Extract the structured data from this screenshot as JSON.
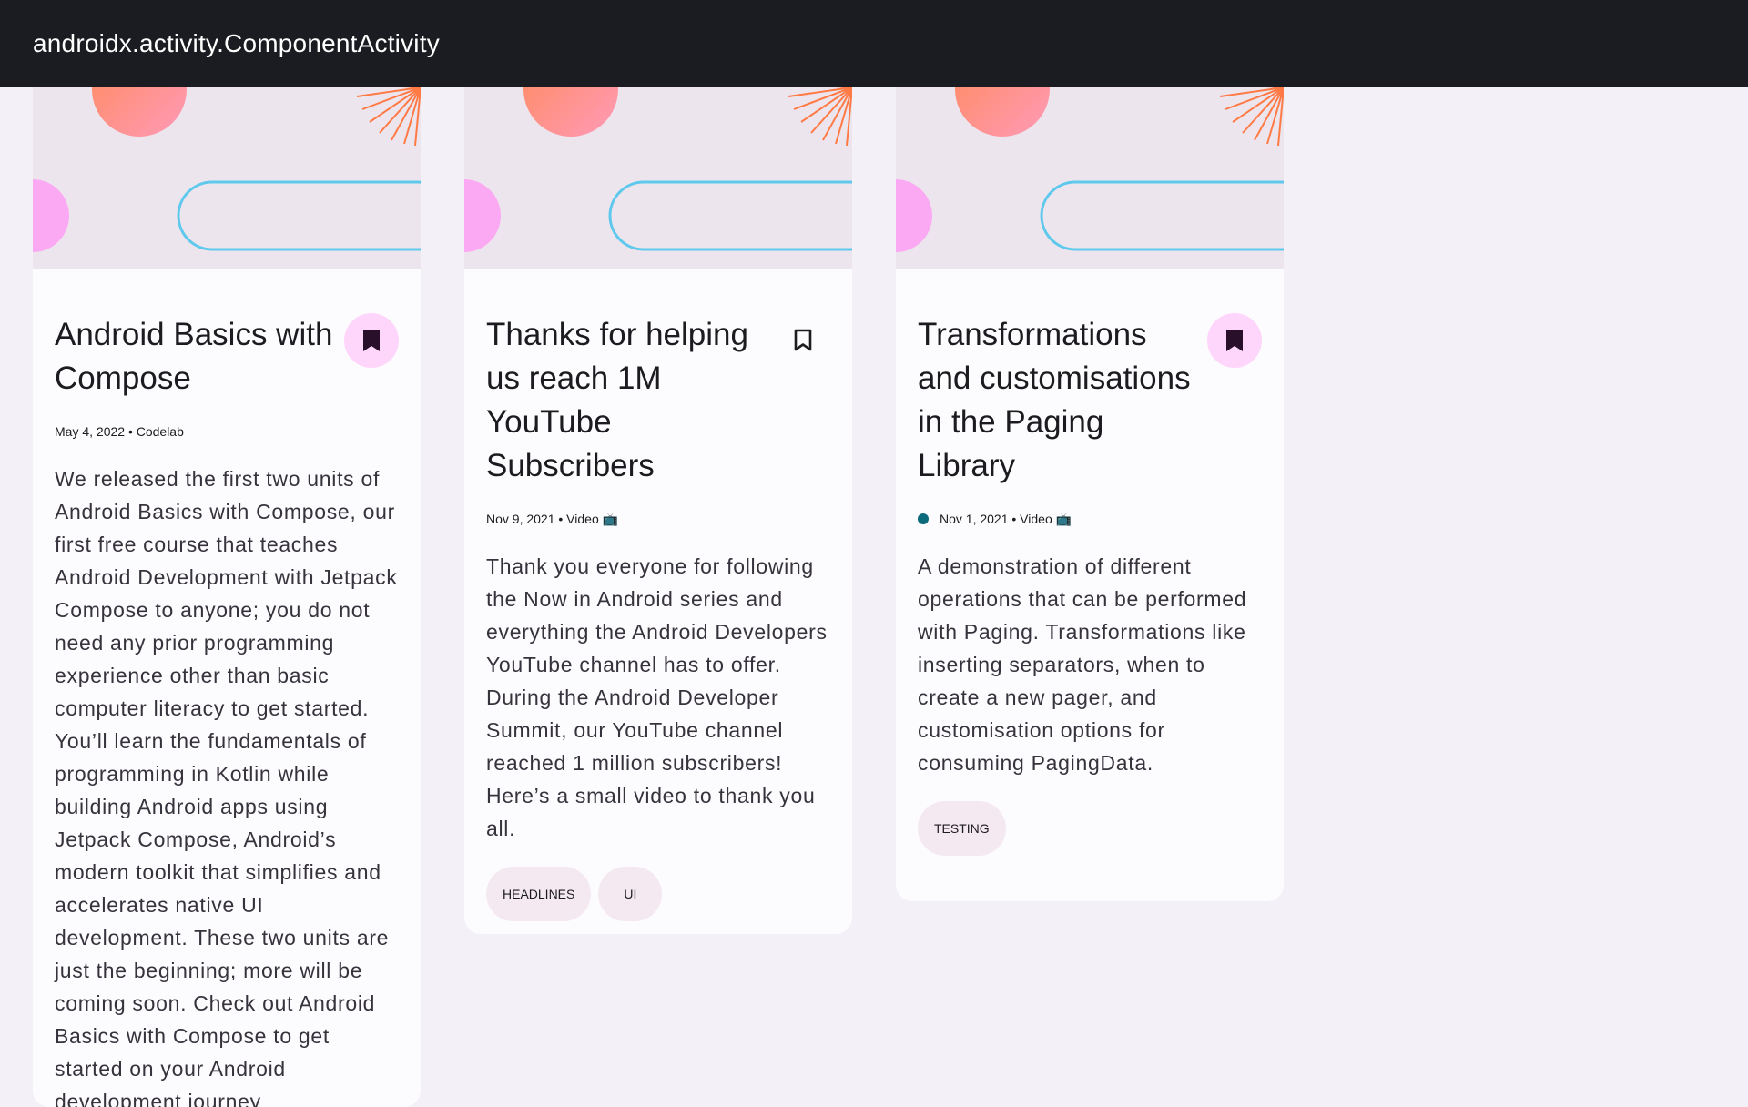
{
  "app": {
    "title": "androidx.activity.ComponentActivity"
  },
  "colors": {
    "titlebar": "#1b1c21",
    "background": "#f3f0f7",
    "card": "#fcfbfd",
    "bookmark_filled_bg": "#ffd6fb",
    "bookmark_icon": "#2a0f2a",
    "chip_bg": "#f4e9f0",
    "unread_dot": "#0b6b7c"
  },
  "cards": [
    {
      "title": "Android Basics with Compose",
      "meta": "May 4, 2022 • Codelab",
      "bookmarked": true,
      "unread": false,
      "description": "We released the first two units of Android Basics with Compose, our first free course that teaches Android Development with Jetpack Compose to anyone; you do not need any prior programming experience other than basic computer literacy to get started. You’ll learn the fundamentals of programming in Kotlin while building Android apps using Jetpack Compose, Android’s modern toolkit that simplifies and accelerates native UI development. These two units are just the beginning; more will be coming soon. Check out Android Basics with Compose to get started on your Android development journey",
      "chips": []
    },
    {
      "title": "Thanks for helping us reach 1M YouTube Subscribers",
      "meta": "Nov 9, 2021 • Video 📺",
      "bookmarked": false,
      "unread": false,
      "description": "Thank you everyone for following the Now in Android series and everything the Android Developers YouTube channel has to offer. During the Android Developer Summit, our YouTube channel reached 1 million subscribers! Here’s a small video to thank you all.",
      "chips": [
        "HEADLINES",
        "UI"
      ]
    },
    {
      "title": "Transformations and customisations in the Paging Library",
      "meta": "Nov 1, 2021 • Video 📺",
      "bookmarked": true,
      "unread": true,
      "description": "A demonstration of different operations that can be performed with Paging. Transformations like inserting separators, when to create a new pager, and customisation options for consuming PagingData.",
      "chips": [
        "TESTING"
      ]
    }
  ]
}
